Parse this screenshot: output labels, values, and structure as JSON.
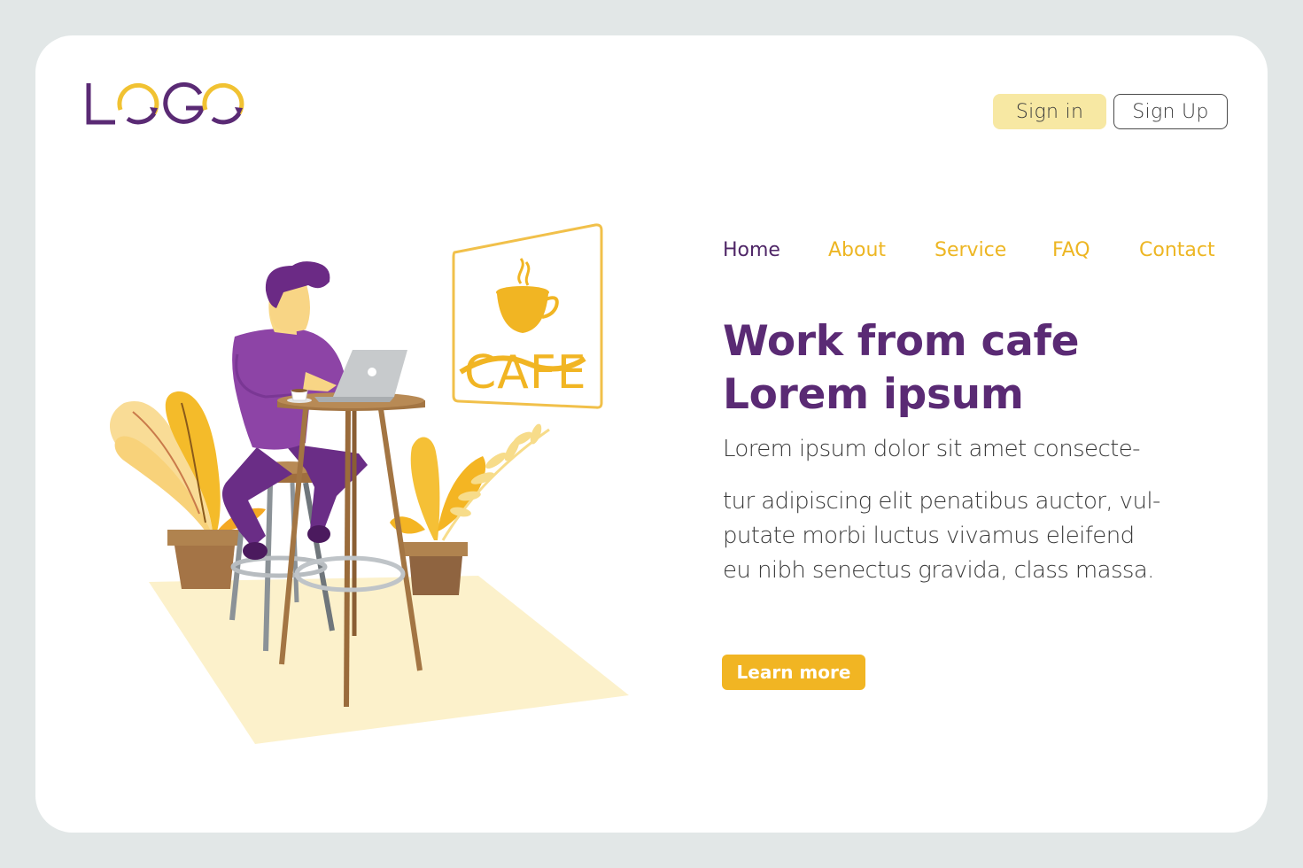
{
  "brand": {
    "logo_text": "LOGO",
    "primary_color": "#5a2a74",
    "accent_color": "#f1b523"
  },
  "header": {
    "sign_in_label": "Sign in",
    "sign_up_label": "Sign Up"
  },
  "nav": {
    "items": [
      {
        "label": "Home",
        "active": true
      },
      {
        "label": "About",
        "active": false
      },
      {
        "label": "Service",
        "active": false
      },
      {
        "label": "FAQ",
        "active": false
      },
      {
        "label": "Contact",
        "active": false
      }
    ]
  },
  "hero": {
    "headline_line1": "Work from cafe",
    "headline_line2": "Lorem ipsum",
    "body_lines": [
      "Lorem ipsum dolor sit amet consecte-",
      "tur adipiscing elit penatibus auctor, vul-",
      "putate morbi luctus vivamus eleifend",
      "eu nibh senectus gravida, class massa."
    ],
    "cta_label": "Learn more"
  },
  "illustration": {
    "sign_text": "CAFE",
    "icons": [
      "coffee-cup-icon",
      "laptop-icon",
      "plant-icon"
    ]
  }
}
